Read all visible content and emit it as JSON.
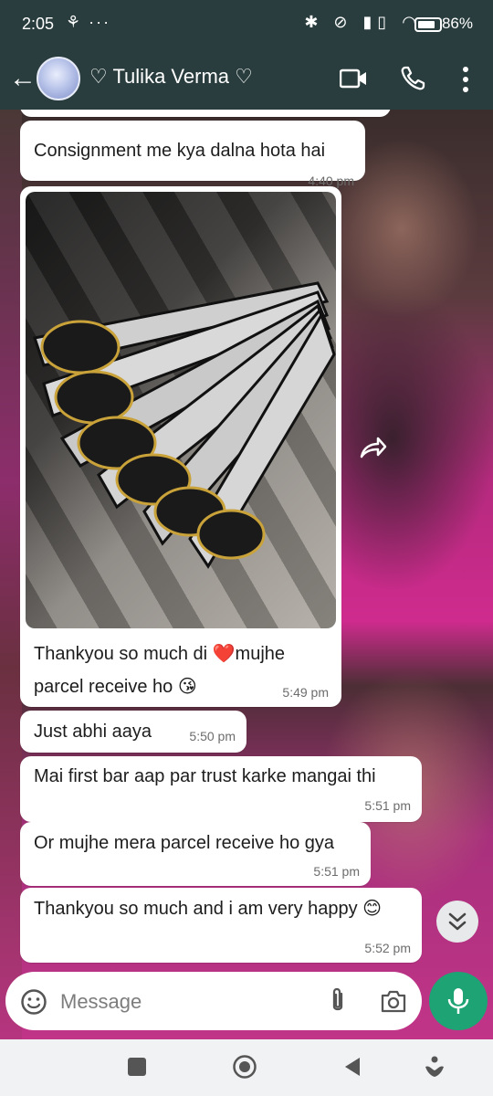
{
  "status_bar": {
    "time": "2:05",
    "left_icons": "⚘ ···",
    "right_icons": "✱ ⊘ ▮▯ ◠",
    "battery_percent": "86%"
  },
  "header": {
    "contact_name": "♡ Tulika Verma ♡"
  },
  "messages": [
    {
      "text": "Consignment me kya dalna hota hai",
      "time": "4:40 pm"
    },
    {
      "text": "Thankyou so much di ❤️mujhe parcel receive ho 😘",
      "time": "5:49 pm"
    },
    {
      "text": "Just abhi aaya",
      "time": "5:50 pm"
    },
    {
      "text": "Mai first bar aap par trust karke mangai thi",
      "time": "5:51 pm"
    },
    {
      "text": "Or mujhe mera parcel receive ho gya",
      "time": "5:51 pm"
    },
    {
      "text": "Thankyou so much and i am very happy 😊",
      "time": "5:52 pm"
    }
  ],
  "input": {
    "placeholder": "Message"
  },
  "colors": {
    "header_bg": "#2a3d3e",
    "accent": "#1da374",
    "bubble": "#ffffff"
  }
}
